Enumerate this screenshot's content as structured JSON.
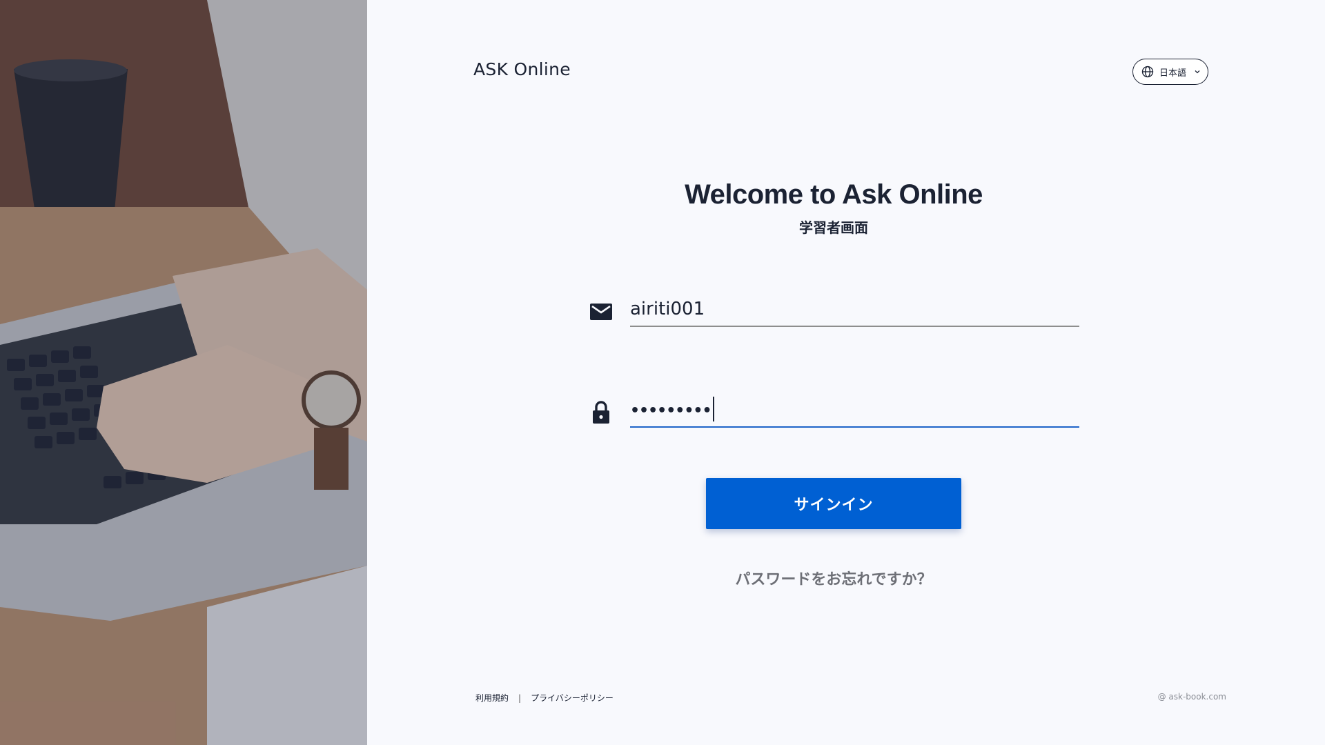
{
  "brand": {
    "name": "ASK Online"
  },
  "language": {
    "selected": "日本語"
  },
  "heading": {
    "title": "Welcome to Ask Online",
    "subtitle": "学習者画面"
  },
  "login": {
    "email_value": "airiti001",
    "password_masked": "•••••••••",
    "signin_label": "サインイン",
    "forgot_label": "パスワードをお忘れですか？"
  },
  "footer": {
    "terms": "利用規約",
    "separator": "|",
    "privacy": "プライバシーポリシー",
    "copyright": "@ ask-book.com"
  },
  "icons": {
    "email": "mail-icon",
    "password": "lock-icon",
    "language": "globe-icon",
    "dropdown": "chevron-down-icon"
  },
  "colors": {
    "accent": "#0060d3",
    "text": "#1b2233",
    "muted": "#6d6f76",
    "background": "#f8f9fd",
    "focus_underline": "#1e64c8"
  }
}
